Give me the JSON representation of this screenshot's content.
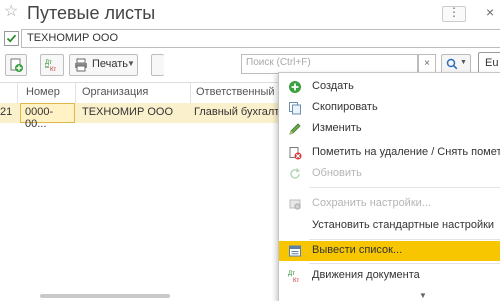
{
  "window": {
    "title": "Путевые листы",
    "close_glyph": "×",
    "more_glyph": "⋮"
  },
  "filter": {
    "organization_value": "ТЕХНОМИР ООО",
    "checked": true
  },
  "toolbar": {
    "print_label": "Печать",
    "search_placeholder": "Поиск (Ctrl+F)",
    "clear_glyph": "×",
    "more_label": "Eu"
  },
  "table": {
    "columns": [
      "Номер",
      "Организация",
      "Ответственный"
    ],
    "rows": [
      {
        "date_fragment": "21",
        "number": "0000-00...",
        "organization": "ТЕХНОМИР ООО",
        "responsible": "Главный бухгалтер"
      }
    ]
  },
  "menu": {
    "items": [
      {
        "label": "Создать",
        "icon": "create-icon",
        "disabled": false
      },
      {
        "label": "Скопировать",
        "icon": "copy-icon",
        "disabled": false
      },
      {
        "label": "Изменить",
        "icon": "edit-icon",
        "disabled": false
      },
      {
        "label": "Пометить на удаление / Снять пометку",
        "icon": "mark-delete-icon",
        "disabled": false
      },
      {
        "label": "Обновить",
        "icon": "refresh-icon",
        "disabled": true
      },
      {
        "label": "Сохранить настройки...",
        "icon": "save-settings-icon",
        "disabled": true
      },
      {
        "label": "Установить стандартные настройки",
        "icon": "",
        "disabled": false
      },
      {
        "label": "Вывести список...",
        "icon": "output-list-icon",
        "disabled": false,
        "highlighted": true
      },
      {
        "label": "Движения документа",
        "icon": "document-movements-icon",
        "disabled": false
      }
    ]
  },
  "colors": {
    "highlight": "#f7c600",
    "selected_row": "#fbf0cc",
    "create_green": "#3aa040"
  }
}
